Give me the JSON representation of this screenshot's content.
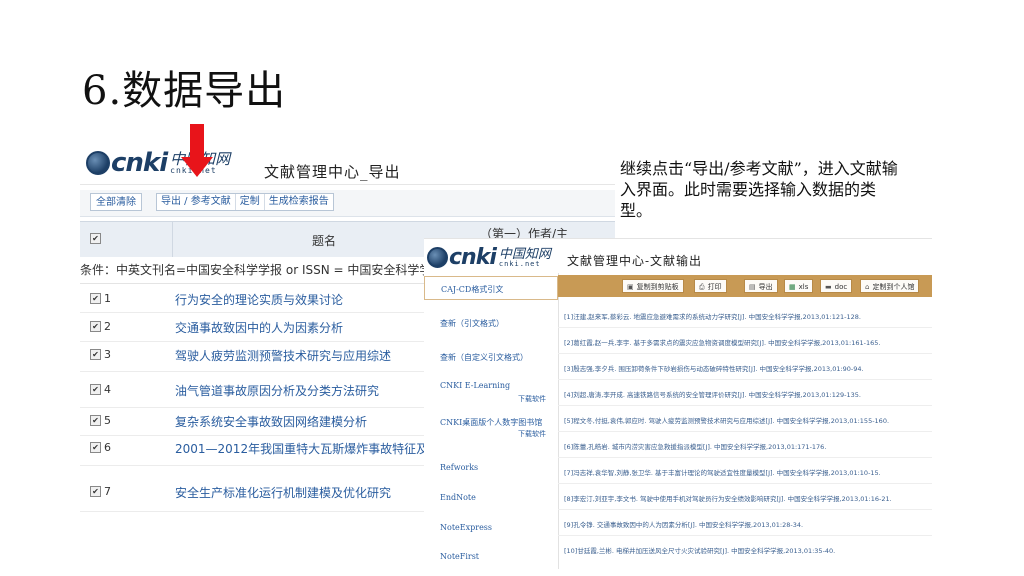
{
  "slide": {
    "title": "6.数据导出",
    "description": "继续点击“导出/参考文献”，进入文献输入界面。此时需要选择输入数据的类型。"
  },
  "colors": {
    "accent_red": "#e8141a",
    "link_blue": "#2a5d9f",
    "toolbar_gold": "#c89a55",
    "cnki_navy": "#1d3f66"
  },
  "screenshot1": {
    "logo": {
      "brand": "cnki",
      "cn": "中国知网",
      "net": "cnki.net"
    },
    "app_title": "文献管理中心_导出",
    "toolbar": {
      "clear_all": "全部清除",
      "export_ref": "导出 / 参考文献",
      "customize": "定制",
      "gen_report": "生成检索报告"
    },
    "table": {
      "header_title": "题名",
      "header_author": "（第一）作者/主",
      "condition": "条件：中英文刊名=中国安全科学学报 or ISSN = 中国安全科学学报 or",
      "rows": [
        {
          "num": "1",
          "title": "行为安全的理论实质与效果讨论"
        },
        {
          "num": "2",
          "title": "交通事故致因中的人为因素分析"
        },
        {
          "num": "3",
          "title": "驾驶人疲劳监测预警技术研究与应用综述"
        },
        {
          "num": "4",
          "title": "油气管道事故原因分析及分类方法研究"
        },
        {
          "num": "5",
          "title": "复杂系统安全事故致因网络建模分析"
        },
        {
          "num": "6",
          "title": "2001—2012年我国重特大瓦斯爆炸事故特征及发生"
        },
        {
          "num": "7",
          "title": "安全生产标准化运行机制建模及优化研究"
        }
      ]
    }
  },
  "screenshot2": {
    "logo": {
      "brand": "cnki",
      "cn": "中国知网",
      "net": "cnki.net"
    },
    "app_title": "文献管理中心-文献输出",
    "sidebar": [
      {
        "label": "CAJ-CD格式引文",
        "sub": ""
      },
      {
        "label": "查新（引文格式）",
        "sub": ""
      },
      {
        "label": "查新（自定义引文格式）",
        "sub": ""
      },
      {
        "label": "CNKI E-Learning",
        "sub": "下载软件"
      },
      {
        "label": "CNKI桌面版个人数字图书馆",
        "sub": "下载软件"
      },
      {
        "label": "Refworks",
        "sub": ""
      },
      {
        "label": "EndNote",
        "sub": ""
      },
      {
        "label": "NoteExpress",
        "sub": ""
      },
      {
        "label": "NoteFirst",
        "sub": ""
      }
    ],
    "toolbar": {
      "copy": "复制到剪贴板",
      "print": "打印",
      "export": "导出",
      "xls": "xls",
      "doc": "doc",
      "custom": "定制到个人馆"
    },
    "citations": [
      "[1]汪建,赵来军,蔡彩云. 地震应急避难需求的系统动力学研究[J]. 中国安全科学学报,2013,01:121-128.",
      "[2]葛红霞,赵一兵,李宇. 基于多需求点的震灾应急物资调度模型研究[J]. 中国安全科学学报,2013,01:161-165.",
      "[3]殷志强,李夕兵. 围压卸荷条件下砂岩损伤与动态破碎特性研究[J]. 中国安全科学学报,2013,01:90-94.",
      "[4]刘超,唐涛,李开成. 高速铁路信号系统的安全管理评价研究[J]. 中国安全科学学报,2013,01:129-135.",
      "[5]程文冬,付挺,袁伟,郭应时. 驾驶人疲劳监测预警技术研究与应用综述[J]. 中国安全科学学报,2013,01:155-160.",
      "[6]陈蕾,孔皓岩. 城市内涝灾害应急救援指派模型[J]. 中国安全科学学报,2013,01:171-176.",
      "[7]冯志祥,袁华智,刘静,张卫华. 基于丰富计理论的驾驶适宜性度量模型[J]. 中国安全科学学报,2013,01:10-15.",
      "[8]李宏汀,刘亚宇,李文书. 驾驶中使用手机对驾驶员行为安全绩效影响研究[J]. 中国安全科学学报,2013,01:16-21.",
      "[9]孔令铮. 交通事故致因中的人为因素分析[J]. 中国安全科学学报,2013,01:28-34.",
      "[10]甘廷霞,兰彬. 电梯井加压送风全尺寸火灾试验研究[J]. 中国安全科学学报,2013,01:35-40."
    ]
  }
}
